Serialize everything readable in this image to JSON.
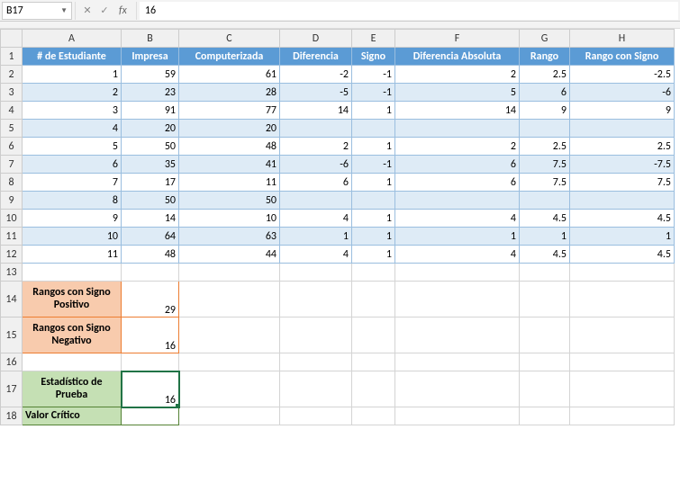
{
  "nameBox": "B17",
  "formulaBar": "16",
  "columns": [
    "A",
    "B",
    "C",
    "D",
    "E",
    "F",
    "G",
    "H"
  ],
  "headerRow": [
    "# de Estudiante",
    "Impresa",
    "Computerizada",
    "Diferencia",
    "Signo",
    "Diferencia Absoluta",
    "Rango",
    "Rango con Signo"
  ],
  "rows": [
    {
      "n": "1",
      "impresa": "59",
      "comp": "61",
      "dif": "-2",
      "signo": "-1",
      "abs": "2",
      "rango": "2.5",
      "rsigno": "-2.5"
    },
    {
      "n": "2",
      "impresa": "23",
      "comp": "28",
      "dif": "-5",
      "signo": "-1",
      "abs": "5",
      "rango": "6",
      "rsigno": "-6"
    },
    {
      "n": "3",
      "impresa": "91",
      "comp": "77",
      "dif": "14",
      "signo": "1",
      "abs": "14",
      "rango": "9",
      "rsigno": "9"
    },
    {
      "n": "4",
      "impresa": "20",
      "comp": "20",
      "dif": "",
      "signo": "",
      "abs": "",
      "rango": "",
      "rsigno": ""
    },
    {
      "n": "5",
      "impresa": "50",
      "comp": "48",
      "dif": "2",
      "signo": "1",
      "abs": "2",
      "rango": "2.5",
      "rsigno": "2.5"
    },
    {
      "n": "6",
      "impresa": "35",
      "comp": "41",
      "dif": "-6",
      "signo": "-1",
      "abs": "6",
      "rango": "7.5",
      "rsigno": "-7.5"
    },
    {
      "n": "7",
      "impresa": "17",
      "comp": "11",
      "dif": "6",
      "signo": "1",
      "abs": "6",
      "rango": "7.5",
      "rsigno": "7.5"
    },
    {
      "n": "8",
      "impresa": "50",
      "comp": "50",
      "dif": "",
      "signo": "",
      "abs": "",
      "rango": "",
      "rsigno": ""
    },
    {
      "n": "9",
      "impresa": "14",
      "comp": "10",
      "dif": "4",
      "signo": "1",
      "abs": "4",
      "rango": "4.5",
      "rsigno": "4.5"
    },
    {
      "n": "10",
      "impresa": "64",
      "comp": "63",
      "dif": "1",
      "signo": "1",
      "abs": "1",
      "rango": "1",
      "rsigno": "1"
    },
    {
      "n": "11",
      "impresa": "48",
      "comp": "44",
      "dif": "4",
      "signo": "1",
      "abs": "4",
      "rango": "4.5",
      "rsigno": "4.5"
    }
  ],
  "labels": {
    "rangosPos": "Rangos con Signo Positivo",
    "rangosPosVal": "29",
    "rangosNeg": "Rangos con Signo Negativo",
    "rangosNegVal": "16",
    "estadistico": "Estadístico de Prueba",
    "estadisticoVal": "16",
    "valorCritico": "Valor Crítico",
    "valorCriticoVal": ""
  },
  "rowNums": [
    "1",
    "2",
    "3",
    "4",
    "5",
    "6",
    "7",
    "8",
    "9",
    "10",
    "11",
    "12",
    "13",
    "14",
    "15",
    "16",
    "17",
    "18"
  ],
  "chart_data": {
    "type": "table",
    "title": "Wilcoxon Signed-Rank Test",
    "columns": [
      "# de Estudiante",
      "Impresa",
      "Computerizada",
      "Diferencia",
      "Signo",
      "Diferencia Absoluta",
      "Rango",
      "Rango con Signo"
    ],
    "data": [
      [
        1,
        59,
        61,
        -2,
        -1,
        2,
        2.5,
        -2.5
      ],
      [
        2,
        23,
        28,
        -5,
        -1,
        5,
        6,
        -6
      ],
      [
        3,
        91,
        77,
        14,
        1,
        14,
        9,
        9
      ],
      [
        4,
        20,
        20,
        null,
        null,
        null,
        null,
        null
      ],
      [
        5,
        50,
        48,
        2,
        1,
        2,
        2.5,
        2.5
      ],
      [
        6,
        35,
        41,
        -6,
        -1,
        6,
        7.5,
        -7.5
      ],
      [
        7,
        17,
        11,
        6,
        1,
        6,
        7.5,
        7.5
      ],
      [
        8,
        50,
        50,
        null,
        null,
        null,
        null,
        null
      ],
      [
        9,
        14,
        10,
        4,
        1,
        4,
        4.5,
        4.5
      ],
      [
        10,
        64,
        63,
        1,
        1,
        1,
        1,
        1
      ],
      [
        11,
        48,
        44,
        4,
        1,
        4,
        4.5,
        4.5
      ]
    ],
    "summary": {
      "sum_positive_ranks": 29,
      "sum_negative_ranks": 16,
      "test_statistic": 16
    }
  }
}
